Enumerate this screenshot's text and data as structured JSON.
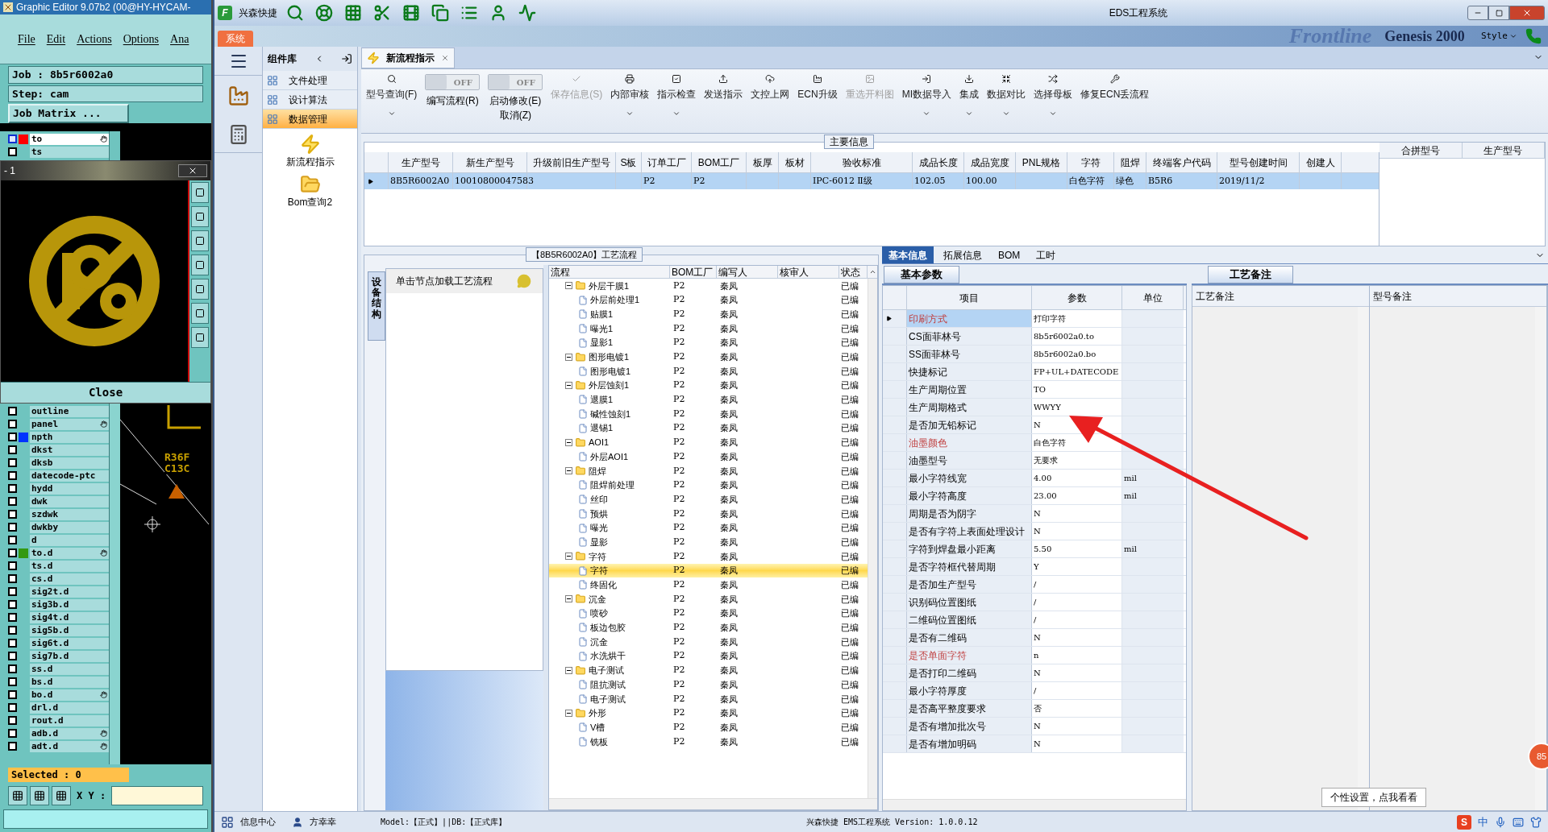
{
  "editor": {
    "title": "Graphic Editor 9.07b2 (00@HY-HYCAM-",
    "menu": [
      "File",
      "Edit",
      "Actions",
      "Options",
      "Ana"
    ],
    "job": "Job : 8b5r6002a0",
    "step": "Step: cam",
    "matrix_button": "Job Matrix ...",
    "layers_top": [
      {
        "name": "to",
        "checked": true,
        "selected": true,
        "hand": true,
        "color": "#ff0000"
      },
      {
        "name": "ts",
        "checked": false,
        "selected": false,
        "hand": false
      }
    ],
    "popup": {
      "title": "- 1",
      "close": "Close"
    },
    "layers": [
      {
        "name": "outline",
        "checked": false,
        "selected": false,
        "hand": false
      },
      {
        "name": "panel",
        "checked": false,
        "selected": false,
        "hand": true
      },
      {
        "name": "npth",
        "checked": false,
        "selected": false,
        "hand": false,
        "color": "#0033ff"
      },
      {
        "name": "dkst",
        "checked": false,
        "selected": false,
        "hand": false
      },
      {
        "name": "dksb",
        "checked": false,
        "selected": false,
        "hand": false
      },
      {
        "name": "datecode-ptc",
        "checked": false,
        "selected": false,
        "hand": false
      },
      {
        "name": "hydd",
        "checked": false,
        "selected": false,
        "hand": false
      },
      {
        "name": "dwk",
        "checked": false,
        "selected": false,
        "hand": false
      },
      {
        "name": "szdwk",
        "checked": false,
        "selected": false,
        "hand": false
      },
      {
        "name": "dwkby",
        "checked": false,
        "selected": false,
        "hand": false
      },
      {
        "name": "d",
        "checked": false,
        "selected": false,
        "hand": false
      },
      {
        "name": "to.d",
        "checked": false,
        "selected": false,
        "hand": true,
        "color": "#339911"
      },
      {
        "name": "ts.d",
        "checked": false,
        "selected": false,
        "hand": false
      },
      {
        "name": "cs.d",
        "checked": false,
        "selected": false,
        "hand": false
      },
      {
        "name": "sig2t.d",
        "checked": false,
        "selected": false,
        "hand": false
      },
      {
        "name": "sig3b.d",
        "checked": false,
        "selected": false,
        "hand": false
      },
      {
        "name": "sig4t.d",
        "checked": false,
        "selected": false,
        "hand": false
      },
      {
        "name": "sig5b.d",
        "checked": false,
        "selected": false,
        "hand": false
      },
      {
        "name": "sig6t.d",
        "checked": false,
        "selected": false,
        "hand": false
      },
      {
        "name": "sig7b.d",
        "checked": false,
        "selected": false,
        "hand": false
      },
      {
        "name": "ss.d",
        "checked": false,
        "selected": false,
        "hand": false
      },
      {
        "name": "bs.d",
        "checked": false,
        "selected": false,
        "hand": false
      },
      {
        "name": "bo.d",
        "checked": false,
        "selected": false,
        "hand": true
      },
      {
        "name": "drl.d",
        "checked": false,
        "selected": false,
        "hand": false
      },
      {
        "name": "rout.d",
        "checked": false,
        "selected": false,
        "hand": false
      },
      {
        "name": "adb.d",
        "checked": false,
        "selected": false,
        "hand": true
      },
      {
        "name": "adt.d",
        "checked": false,
        "selected": false,
        "hand": true
      }
    ],
    "canvas_texts": [
      "R36F",
      "C13C"
    ],
    "selected_count": "Selected : 0",
    "xy_label": "X Y :"
  },
  "eds": {
    "logo_letter": "F",
    "app_name": "兴森快捷",
    "title": "EDS工程系统",
    "backdrop_logo": "Frontline",
    "backdrop_product": "Genesis 2000",
    "style_label": "Style",
    "ribbon_tab": "系统",
    "library": {
      "title": "组件库",
      "modules": [
        {
          "label": "文件处理",
          "selected": false
        },
        {
          "label": "设计算法",
          "selected": false
        },
        {
          "label": "数据管理",
          "selected": true
        }
      ],
      "items": [
        "新流程指示",
        "Bom查询2"
      ]
    },
    "doc_tab": {
      "label": "新流程指示"
    },
    "toolbar": [
      {
        "kind": "button",
        "label": "型号查询(F)",
        "dropdown": true,
        "disabled": false
      },
      {
        "kind": "toggle",
        "label": "编写流程(R)",
        "state_text": "OFF",
        "on": false
      },
      {
        "kind": "toggle",
        "label": "启动修改(E)",
        "label_2": "取消(Z)",
        "state_text": "OFF",
        "on": false
      },
      {
        "kind": "button",
        "label": "保存信息(S)",
        "dropdown": false,
        "disabled": true
      },
      {
        "kind": "button",
        "label": "内部审核",
        "dropdown": true,
        "disabled": false
      },
      {
        "kind": "button",
        "label": "指示检查",
        "dropdown": true,
        "disabled": false
      },
      {
        "kind": "button",
        "label": "发送指示",
        "dropdown": false,
        "disabled": false
      },
      {
        "kind": "button",
        "label": "文控上网",
        "dropdown": false,
        "disabled": false
      },
      {
        "kind": "button",
        "label": "ECN升级",
        "dropdown": false,
        "disabled": false
      },
      {
        "kind": "button",
        "label": "重选开料图",
        "dropdown": false,
        "disabled": true
      },
      {
        "kind": "button",
        "label": "MI数据导入",
        "dropdown": true,
        "disabled": false
      },
      {
        "kind": "button",
        "label": "集成",
        "dropdown": true,
        "disabled": false
      },
      {
        "kind": "button",
        "label": "数据对比",
        "dropdown": true,
        "disabled": false
      },
      {
        "kind": "button",
        "label": "选择母板",
        "dropdown": true,
        "disabled": false
      },
      {
        "kind": "button",
        "label": "修复ECN丢流程",
        "dropdown": false,
        "disabled": false
      }
    ],
    "main_info": {
      "title": "主要信息",
      "columns": [
        "生产型号",
        "新生产型号",
        "升级前旧生产型号",
        "S板",
        "订单工厂",
        "BOM工厂",
        "板厚",
        "板材",
        "验收标准",
        "成品长度",
        "成品宽度",
        "PNL规格",
        "字符",
        "阻焊",
        "终端客户代码",
        "型号创建时间",
        "创建人"
      ],
      "rows": [
        {
          "selected": true,
          "cells": [
            "8B5R6002A0",
            "10010800047583",
            null,
            null,
            "P2",
            "P2",
            null,
            null,
            "IPC-6012 Ⅱ级",
            "102.05",
            "100.00",
            null,
            "白色字符",
            "绿色",
            "B5R6",
            "2019/11/2",
            null
          ]
        }
      ],
      "side_columns": [
        "合拼型号",
        "生产型号"
      ]
    },
    "flow": {
      "title": "【8B5R6002A0】工艺流程",
      "side_tab": "设备结构",
      "hint": "单击节点加载工艺流程",
      "columns": [
        "流程",
        "BOM工厂",
        "编写人",
        "核审人",
        "状态"
      ],
      "tree": [
        {
          "name": "外层干膜1",
          "bom": "P2",
          "writer": "秦凤",
          "status": "已编",
          "selected": false,
          "expanded": true,
          "children": [
            {
              "name": "外层前处理1",
              "bom": "P2",
              "writer": "秦凤",
              "status": "已编",
              "selected": false
            },
            {
              "name": "贴膜1",
              "bom": "P2",
              "writer": "秦凤",
              "status": "已编",
              "selected": false
            },
            {
              "name": "曝光1",
              "bom": "P2",
              "writer": "秦凤",
              "status": "已编",
              "selected": false
            },
            {
              "name": "显影1",
              "bom": "P2",
              "writer": "秦凤",
              "status": "已编",
              "selected": false
            }
          ]
        },
        {
          "name": "图形电镀1",
          "bom": "P2",
          "writer": "秦凤",
          "status": "已编",
          "selected": false,
          "expanded": true,
          "children": [
            {
              "name": "图形电镀1",
              "bom": "P2",
              "writer": "秦凤",
              "status": "已编",
              "selected": false
            }
          ]
        },
        {
          "name": "外层蚀刻1",
          "bom": "P2",
          "writer": "秦凤",
          "status": "已编",
          "selected": false,
          "expanded": true,
          "children": [
            {
              "name": "退膜1",
              "bom": "P2",
              "writer": "秦凤",
              "status": "已编",
              "selected": false
            },
            {
              "name": "碱性蚀刻1",
              "bom": "P2",
              "writer": "秦凤",
              "status": "已编",
              "selected": false
            },
            {
              "name": "退锡1",
              "bom": "P2",
              "writer": "秦凤",
              "status": "已编",
              "selected": false
            }
          ]
        },
        {
          "name": "AOI1",
          "bom": "P2",
          "writer": "秦凤",
          "status": "已编",
          "selected": false,
          "expanded": true,
          "children": [
            {
              "name": "外层AOI1",
              "bom": "P2",
              "writer": "秦凤",
              "status": "已编",
              "selected": false
            }
          ]
        },
        {
          "name": "阻焊",
          "bom": "P2",
          "writer": "秦凤",
          "status": "已编",
          "selected": false,
          "expanded": true,
          "children": [
            {
              "name": "阻焊前处理",
              "bom": "P2",
              "writer": "秦凤",
              "status": "已编",
              "selected": false
            },
            {
              "name": "丝印",
              "bom": "P2",
              "writer": "秦凤",
              "status": "已编",
              "selected": false
            },
            {
              "name": "预烘",
              "bom": "P2",
              "writer": "秦凤",
              "status": "已编",
              "selected": false
            },
            {
              "name": "曝光",
              "bom": "P2",
              "writer": "秦凤",
              "status": "已编",
              "selected": false
            },
            {
              "name": "显影",
              "bom": "P2",
              "writer": "秦凤",
              "status": "已编",
              "selected": false
            }
          ]
        },
        {
          "name": "字符",
          "bom": "P2",
          "writer": "秦凤",
          "status": "已编",
          "selected": false,
          "expanded": true,
          "children": [
            {
              "name": "字符",
              "bom": "P2",
              "writer": "秦凤",
              "status": "已编",
              "selected": true
            },
            {
              "name": "终固化",
              "bom": "P2",
              "writer": "秦凤",
              "status": "已编",
              "selected": false
            }
          ]
        },
        {
          "name": "沉金",
          "bom": "P2",
          "writer": "秦凤",
          "status": "已编",
          "selected": false,
          "expanded": true,
          "children": [
            {
              "name": "喷砂",
              "bom": "P2",
              "writer": "秦凤",
              "status": "已编",
              "selected": false
            },
            {
              "name": "板边包胶",
              "bom": "P2",
              "writer": "秦凤",
              "status": "已编",
              "selected": false
            },
            {
              "name": "沉金",
              "bom": "P2",
              "writer": "秦凤",
              "status": "已编",
              "selected": false
            },
            {
              "name": "水洗烘干",
              "bom": "P2",
              "writer": "秦凤",
              "status": "已编",
              "selected": false
            }
          ]
        },
        {
          "name": "电子测试",
          "bom": "P2",
          "writer": "秦凤",
          "status": "已编",
          "selected": false,
          "expanded": true,
          "children": [
            {
              "name": "阻抗测试",
              "bom": "P2",
              "writer": "秦凤",
              "status": "已编",
              "selected": false
            },
            {
              "name": "电子测试",
              "bom": "P2",
              "writer": "秦凤",
              "status": "已编",
              "selected": false
            }
          ]
        },
        {
          "name": "外形",
          "bom": "P2",
          "writer": "秦凤",
          "status": "已编",
          "selected": false,
          "expanded": true,
          "children": [
            {
              "name": "V槽",
              "bom": "P2",
              "writer": "秦凤",
              "status": "已编",
              "selected": false
            },
            {
              "name": "铣板",
              "bom": "P2",
              "writer": "秦凤",
              "status": "已编",
              "selected": false
            }
          ]
        }
      ]
    },
    "detail_tabs": [
      {
        "label": "基本信息",
        "selected": true
      },
      {
        "label": "拓展信息",
        "selected": false
      },
      {
        "label": "BOM",
        "selected": false
      },
      {
        "label": "工时",
        "selected": false
      }
    ],
    "params": {
      "tab": "基本参数",
      "columns": [
        "项目",
        "参数",
        "单位"
      ],
      "rows": [
        {
          "item": "印刷方式",
          "value": "打印字符",
          "flagged": true,
          "selected": true
        },
        {
          "item": "CS面菲林号",
          "value": "8b5r6002a0.to",
          "flagged": false,
          "selected": false
        },
        {
          "item": "SS面菲林号",
          "value": "8b5r6002a0.bo",
          "flagged": false,
          "selected": false
        },
        {
          "item": "快捷标记",
          "value": "FP+UL+DATECODE",
          "flagged": false,
          "selected": false
        },
        {
          "item": "生产周期位置",
          "value": "TO",
          "flagged": false,
          "selected": false
        },
        {
          "item": "生产周期格式",
          "value": "WWYY",
          "flagged": false,
          "selected": false
        },
        {
          "item": "是否加无铅标记",
          "value": "N",
          "flagged": false,
          "selected": false
        },
        {
          "item": "油墨颜色",
          "value": "白色字符",
          "flagged": true,
          "selected": false
        },
        {
          "item": "油墨型号",
          "value": "无要求",
          "flagged": false,
          "selected": false
        },
        {
          "item": "最小字符线宽",
          "value": "4.00",
          "unit": "mil",
          "flagged": false,
          "selected": false
        },
        {
          "item": "最小字符高度",
          "value": "23.00",
          "unit": "mil",
          "flagged": false,
          "selected": false
        },
        {
          "item": "周期是否为阴字",
          "value": "N",
          "flagged": false,
          "selected": false
        },
        {
          "item": "是否有字符上表面处理设计",
          "value": "N",
          "flagged": false,
          "selected": false
        },
        {
          "item": "字符到焊盘最小距离",
          "value": "5.50",
          "unit": "mil",
          "flagged": false,
          "selected": false
        },
        {
          "item": "是否字符框代替周期",
          "value": "Y",
          "flagged": false,
          "selected": false
        },
        {
          "item": "是否加生产型号",
          "value": "/",
          "flagged": false,
          "selected": false
        },
        {
          "item": "识别码位置图纸",
          "value": "/",
          "flagged": false,
          "selected": false
        },
        {
          "item": "二维码位置图纸",
          "value": "/",
          "flagged": false,
          "selected": false
        },
        {
          "item": "是否有二维码",
          "value": "N",
          "flagged": false,
          "selected": false
        },
        {
          "item": "是否单面字符",
          "value": "n",
          "flagged": true,
          "selected": false
        },
        {
          "item": "是否打印二维码",
          "value": "N",
          "flagged": false,
          "selected": false
        },
        {
          "item": "最小字符厚度",
          "value": "/",
          "flagged": false,
          "selected": false
        },
        {
          "item": "是否高平整度要求",
          "value": "否",
          "flagged": false,
          "selected": false
        },
        {
          "item": "是否有增加批次号",
          "value": "N",
          "flagged": false,
          "selected": false
        },
        {
          "item": "是否有增加明码",
          "value": "N",
          "flagged": false,
          "selected": false
        }
      ]
    },
    "notes": {
      "tab": "工艺备注",
      "columns": [
        "工艺备注",
        "型号备注"
      ]
    },
    "badge": "85",
    "tooltip": "个性设置，点我看看",
    "status_bar": {
      "info_center": "信息中心",
      "user": "方幸幸",
      "db_info": "Model:【正式】||DB:【正式库】",
      "version": "兴森快捷 EMS工程系统 Version: 1.0.0.12",
      "ime_logo": "S",
      "ime": "中"
    }
  }
}
